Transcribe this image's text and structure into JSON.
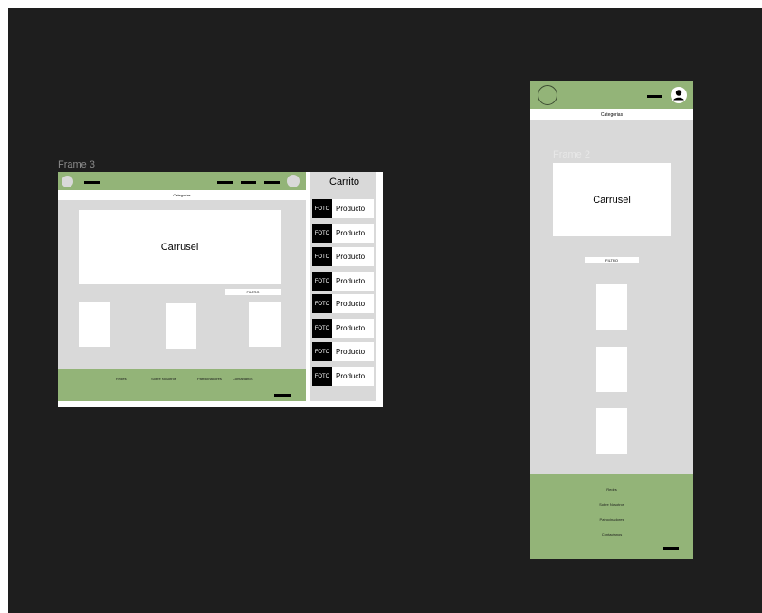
{
  "colors": {
    "canvas": "#1e1e1e",
    "header": "#93b478",
    "body": "#d9d9d9",
    "card": "#ffffff"
  },
  "desktop": {
    "frame_label": "Frame 3",
    "categories_label": "Categorias",
    "carousel_label": "Carrusel",
    "filter_label": "FILTRO",
    "footer_links": [
      "Redes",
      "Sobre Nosotros",
      "Patrocinadores",
      "Contactanos"
    ],
    "cart": {
      "title": "Carrito",
      "items": [
        {
          "photo": "FOTO",
          "name": "Producto"
        },
        {
          "photo": "FOTO",
          "name": "Producto"
        },
        {
          "photo": "FOTO",
          "name": "Producto"
        },
        {
          "photo": "FOTO",
          "name": "Producto"
        },
        {
          "photo": "FOTO",
          "name": "Producto"
        },
        {
          "photo": "FOTO",
          "name": "Producto"
        },
        {
          "photo": "FOTO",
          "name": "Producto"
        },
        {
          "photo": "FOTO",
          "name": "Producto"
        }
      ]
    }
  },
  "mobile": {
    "frame_label": "Frame 2",
    "categories_label": "Categorias",
    "carousel_label": "Carrusel",
    "filter_label": "FILTRO",
    "footer_links": [
      "Redes",
      "Sobre Nosotros",
      "Patrocinadores",
      "Contactanos"
    ]
  }
}
